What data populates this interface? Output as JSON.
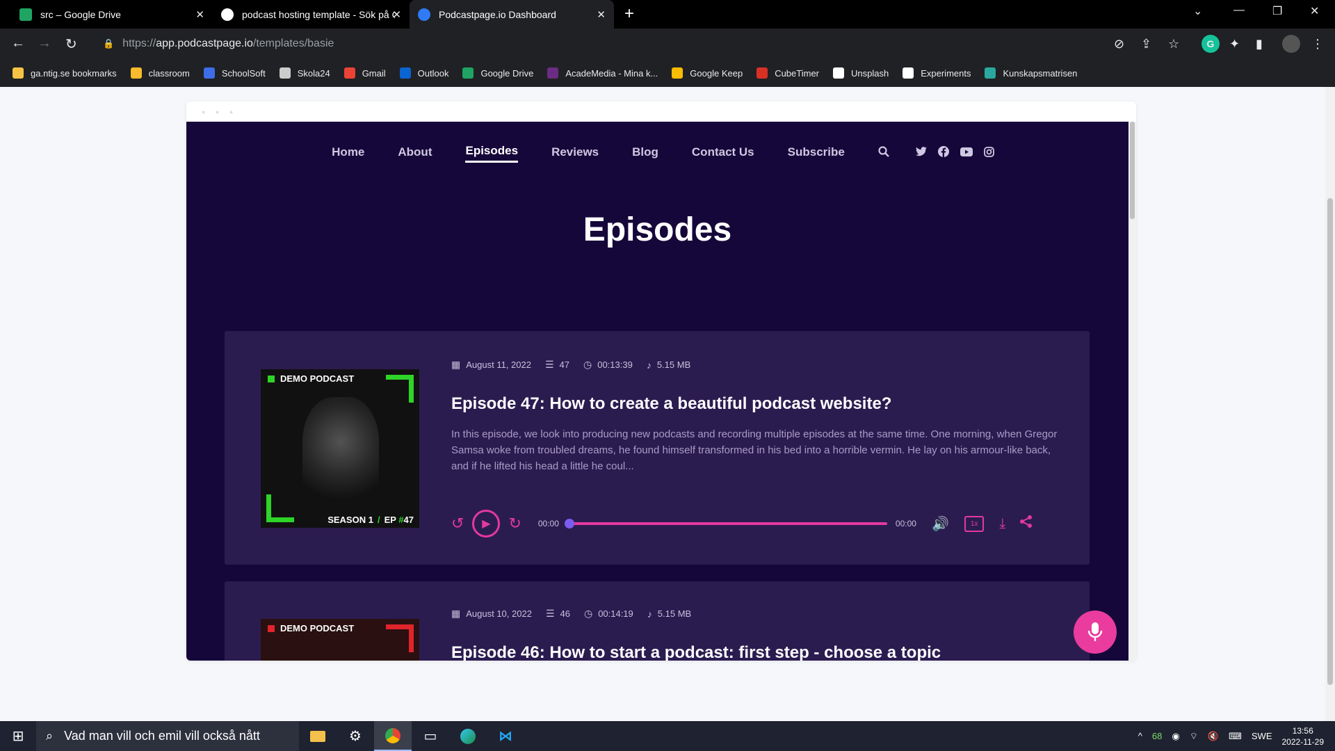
{
  "browser": {
    "tabs": [
      {
        "title": "src – Google Drive",
        "color": "#1fa463"
      },
      {
        "title": "podcast hosting template - Sök på Google",
        "color": "#4285f4"
      },
      {
        "title": "Podcastpage.io Dashboard",
        "color": "#2f7bf5"
      }
    ],
    "url_scheme": "https://",
    "url_host": "app.podcastpage.io",
    "url_path": "/templates/basie",
    "bookmarks": [
      {
        "label": "ga.ntig.se bookmarks",
        "color": "#f6c344"
      },
      {
        "label": "classroom",
        "color": "#f9bb2b"
      },
      {
        "label": "SchoolSoft",
        "color": "#3d6ee8"
      },
      {
        "label": "Skola24",
        "color": "#cccccc"
      },
      {
        "label": "Gmail",
        "color": "#ea4335"
      },
      {
        "label": "Outlook",
        "color": "#0a64d1"
      },
      {
        "label": "Google Drive",
        "color": "#1fa463"
      },
      {
        "label": "AcadeMedia - Mina k...",
        "color": "#6b2c85"
      },
      {
        "label": "Google Keep",
        "color": "#fbbc04"
      },
      {
        "label": "CubeTimer",
        "color": "#d93025"
      },
      {
        "label": "Unsplash",
        "color": "#ffffff"
      },
      {
        "label": "Experiments",
        "color": "#ffffff"
      },
      {
        "label": "Kunskapsmatrisen",
        "color": "#2aa8a0"
      }
    ]
  },
  "site": {
    "nav": [
      "Home",
      "About",
      "Episodes",
      "Reviews",
      "Blog",
      "Contact Us",
      "Subscribe"
    ],
    "current_nav": "Episodes",
    "heading": "Episodes",
    "episodes": [
      {
        "date": "August 11, 2022",
        "number": "47",
        "duration": "00:13:39",
        "size": "5.15 MB",
        "title": "Episode 47: How to create a beautiful podcast website?",
        "description": "In this episode, we look into producing new podcasts and recording multiple episodes at the same time. One morning, when Gregor Samsa woke from troubled dreams, he found himself transformed in his bed into a horrible vermin. He lay on his armour-like back, and if he lifted his head a little he coul...",
        "cover_brand": "DEMO PODCAST",
        "cover_season": "SEASON 1",
        "cover_ep_prefix": "EP",
        "cover_ep_hash": "#",
        "cover_ep_num": "47",
        "time_current": "00:00",
        "time_total": "00:00",
        "progress": 0,
        "speed": "1x"
      },
      {
        "date": "August 10, 2022",
        "number": "46",
        "duration": "00:14:19",
        "size": "5.15 MB",
        "title": "Episode 46: How to start a podcast: first step - choose a topic",
        "cover_brand": "DEMO PODCAST"
      }
    ]
  },
  "taskbar": {
    "search_placeholder": "Vad man vill och emil vill också nått",
    "battery": "68",
    "language": "SWE",
    "time": "13:56",
    "date": "2022-11-29"
  },
  "colors": {
    "accent": "#e3399f",
    "site_bg": "#16073a",
    "card_bg": "#2b1c50",
    "cover_accent": "#2ed428"
  }
}
